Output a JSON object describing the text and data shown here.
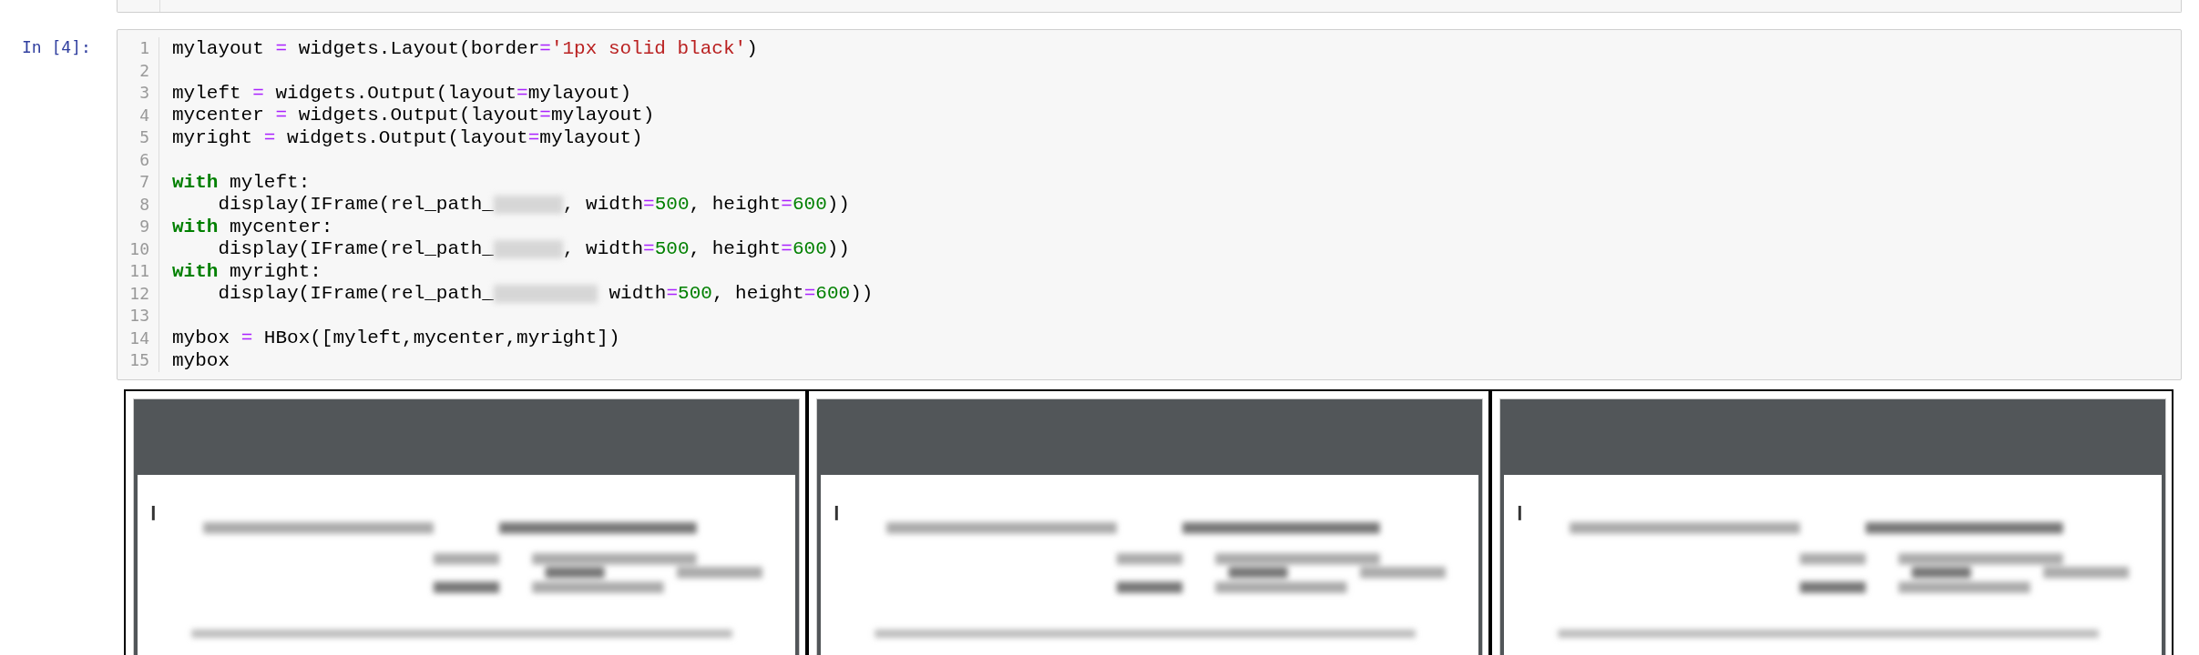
{
  "cell": {
    "prompt": "In [4]:",
    "lines": [
      {
        "number": "1",
        "tokens": [
          {
            "kind": "plain",
            "text": "mylayout "
          },
          {
            "kind": "operator",
            "text": "="
          },
          {
            "kind": "plain",
            "text": " widgets.Layout(border"
          },
          {
            "kind": "operator",
            "text": "="
          },
          {
            "kind": "string",
            "text": "'1px solid black'"
          },
          {
            "kind": "plain",
            "text": ")"
          }
        ]
      },
      {
        "number": "2"
      },
      {
        "number": "3",
        "tokens": [
          {
            "kind": "plain",
            "text": "myleft "
          },
          {
            "kind": "operator",
            "text": "="
          },
          {
            "kind": "plain",
            "text": " widgets.Output(layout"
          },
          {
            "kind": "operator",
            "text": "="
          },
          {
            "kind": "plain",
            "text": "mylayout)"
          }
        ]
      },
      {
        "number": "4",
        "tokens": [
          {
            "kind": "plain",
            "text": "mycenter "
          },
          {
            "kind": "operator",
            "text": "="
          },
          {
            "kind": "plain",
            "text": " widgets.Output(layout"
          },
          {
            "kind": "operator",
            "text": "="
          },
          {
            "kind": "plain",
            "text": "mylayout)"
          }
        ]
      },
      {
        "number": "5",
        "tokens": [
          {
            "kind": "plain",
            "text": "myright "
          },
          {
            "kind": "operator",
            "text": "="
          },
          {
            "kind": "plain",
            "text": " widgets.Output(layout"
          },
          {
            "kind": "operator",
            "text": "="
          },
          {
            "kind": "plain",
            "text": "mylayout)"
          }
        ]
      },
      {
        "number": "6"
      },
      {
        "number": "7",
        "tokens": [
          {
            "kind": "keyword",
            "text": "with"
          },
          {
            "kind": "plain",
            "text": " myleft:"
          }
        ]
      },
      {
        "number": "8",
        "tokens": [
          {
            "kind": "plain",
            "text": "    display(IFrame(rel_path_"
          },
          {
            "kind": "redacted_short"
          },
          {
            "kind": "plain",
            "text": ", width"
          },
          {
            "kind": "operator",
            "text": "="
          },
          {
            "kind": "number",
            "text": "500"
          },
          {
            "kind": "plain",
            "text": ", height"
          },
          {
            "kind": "operator",
            "text": "="
          },
          {
            "kind": "number",
            "text": "600"
          },
          {
            "kind": "plain",
            "text": "))"
          }
        ]
      },
      {
        "number": "9",
        "tokens": [
          {
            "kind": "keyword",
            "text": "with"
          },
          {
            "kind": "plain",
            "text": " mycenter:"
          }
        ]
      },
      {
        "number": "10",
        "tokens": [
          {
            "kind": "plain",
            "text": "    display(IFrame(rel_path_"
          },
          {
            "kind": "redacted_short"
          },
          {
            "kind": "plain",
            "text": ", width"
          },
          {
            "kind": "operator",
            "text": "="
          },
          {
            "kind": "number",
            "text": "500"
          },
          {
            "kind": "plain",
            "text": ", height"
          },
          {
            "kind": "operator",
            "text": "="
          },
          {
            "kind": "number",
            "text": "600"
          },
          {
            "kind": "plain",
            "text": "))"
          }
        ]
      },
      {
        "number": "11",
        "tokens": [
          {
            "kind": "keyword",
            "text": "with"
          },
          {
            "kind": "plain",
            "text": " myright:"
          }
        ]
      },
      {
        "number": "12",
        "tokens": [
          {
            "kind": "plain",
            "text": "    display(IFrame(rel_path_"
          },
          {
            "kind": "redacted_long"
          },
          {
            "kind": "plain",
            "text": " width"
          },
          {
            "kind": "operator",
            "text": "="
          },
          {
            "kind": "number",
            "text": "500"
          },
          {
            "kind": "plain",
            "text": ", height"
          },
          {
            "kind": "operator",
            "text": "="
          },
          {
            "kind": "number",
            "text": "600"
          },
          {
            "kind": "plain",
            "text": "))"
          }
        ]
      },
      {
        "number": "13"
      },
      {
        "number": "14",
        "tokens": [
          {
            "kind": "plain",
            "text": "mybox "
          },
          {
            "kind": "operator",
            "text": "="
          },
          {
            "kind": "plain",
            "text": " HBox([myleft,mycenter,myright])"
          }
        ]
      },
      {
        "number": "15",
        "tokens": [
          {
            "kind": "plain",
            "text": "mybox"
          }
        ]
      }
    ]
  }
}
